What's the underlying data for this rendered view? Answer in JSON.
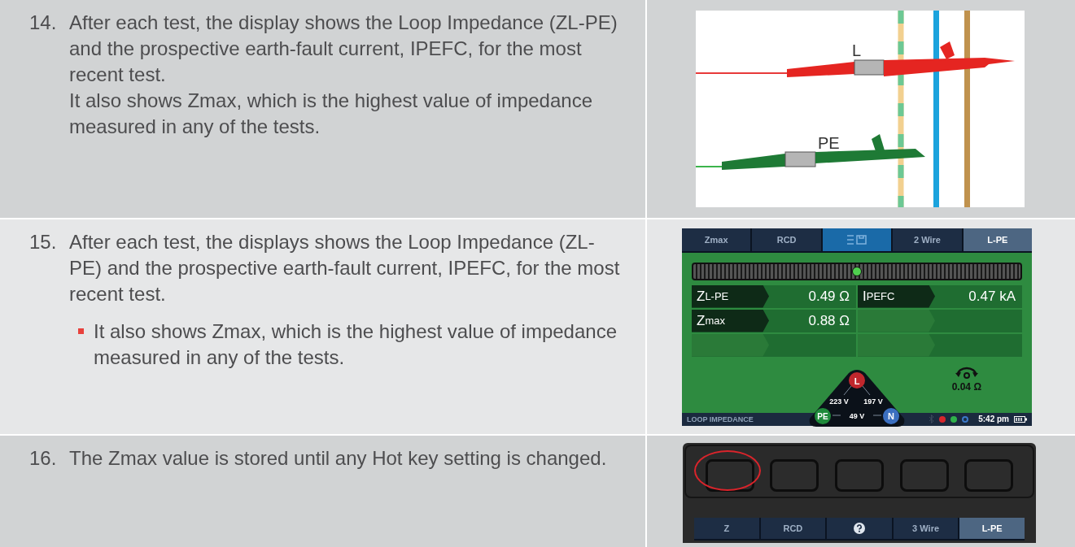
{
  "steps": [
    {
      "number": "14.",
      "paragraphs": [
        "After each test, the display shows the Loop Impedance (ZL-PE) and the prospective earth-fault current, IPEFC, for the most recent test.",
        "It also shows Zmax, which is the highest value of impedance measured in any of the tests."
      ],
      "figure": {
        "kind": "leads",
        "labels": [
          "L",
          "PE"
        ]
      }
    },
    {
      "number": "15.",
      "paragraphs": [
        "After each test, the displays shows the Loop Impedance (ZL-PE) and the prospective earth-fault current, IPEFC, for the most recent test."
      ],
      "bullets": [
        "It also shows Zmax, which is the highest value of impedance measured in any of the tests."
      ],
      "figure": {
        "kind": "display",
        "tabs": [
          {
            "kind": "text",
            "label": "Zmax",
            "selected": false
          },
          {
            "kind": "text",
            "label": "RCD",
            "selected": false
          },
          {
            "kind": "icon",
            "selected": false
          },
          {
            "kind": "text",
            "label": "2 Wire",
            "selected": false
          },
          {
            "kind": "text",
            "label": "L-PE",
            "selected": true
          }
        ],
        "meter": {
          "level": 0.5
        },
        "readings": [
          [
            {
              "kind": "reading",
              "symbol": "Z",
              "qualifier": "L-PE",
              "value": "0.49 Ω"
            },
            {
              "kind": "reading",
              "symbol": "I",
              "qualifier": "PEFC",
              "value": "0.47 kA"
            }
          ],
          [
            {
              "kind": "reading",
              "symbol": "Z",
              "qualifier": "max",
              "value": "0.88 Ω"
            },
            {
              "kind": "blank"
            }
          ],
          [
            {
              "kind": "blank"
            },
            {
              "kind": "blank"
            }
          ]
        ],
        "nodes": {
          "top": "L",
          "left": "PE",
          "right": "N"
        },
        "voltages": {
          "left": "223 V",
          "right": "197 V",
          "bottom": "49 V"
        },
        "lead_null": "0.04 Ω",
        "status": {
          "mode": "LOOP IMPEDANCE",
          "indicators": [
            {
              "kind": "dot",
              "color": "#d7262c"
            },
            {
              "kind": "dot",
              "color": "#2fb14b"
            },
            {
              "kind": "ring",
              "color": "#3b78c8"
            }
          ],
          "time": "5:42 pm"
        }
      }
    },
    {
      "number": "16.",
      "paragraphs": [
        "The Zmax value is stored until any Hot key setting is changed."
      ],
      "figure": {
        "kind": "keypad",
        "keys": [
          {
            "selected": true
          },
          {
            "selected": false
          },
          {
            "selected": false
          },
          {
            "selected": false
          },
          {
            "selected": false
          }
        ],
        "tabs": [
          {
            "kind": "text",
            "label": "Z",
            "selected": false
          },
          {
            "kind": "text",
            "label": "RCD",
            "selected": false
          },
          {
            "kind": "help",
            "selected": false
          },
          {
            "kind": "text",
            "label": "3 Wire",
            "selected": false
          },
          {
            "kind": "text",
            "label": "L-PE",
            "selected": true
          }
        ]
      }
    }
  ]
}
